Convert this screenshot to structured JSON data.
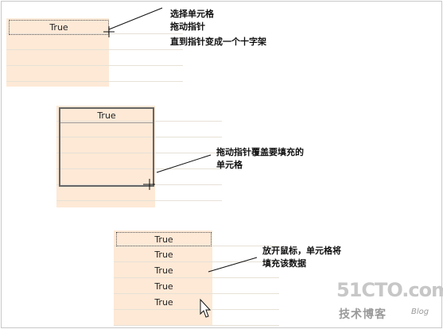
{
  "step1": {
    "cell_value": "True",
    "note_lines": [
      "选择单元格",
      "拖动指针",
      "直到指针变成一个十字架"
    ]
  },
  "step2": {
    "cell_value": "True",
    "note_lines": [
      "拖动指针覆盖要填充的",
      "单元格"
    ]
  },
  "step3": {
    "cell_values": [
      "True",
      "True",
      "True",
      "True",
      "True"
    ],
    "note_lines": [
      "放开鼠标，单元格将",
      "填充该数据"
    ]
  },
  "watermark": {
    "site": "51CTO.com",
    "cn": "技术博客",
    "blog": "Blog"
  }
}
